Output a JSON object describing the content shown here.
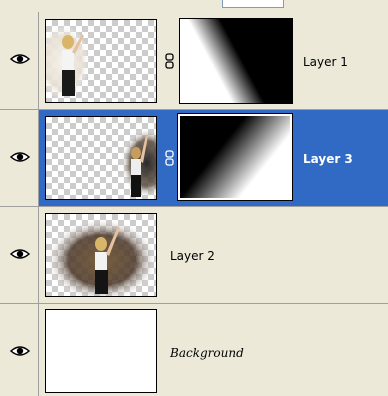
{
  "layers": [
    {
      "name": "Layer 1"
    },
    {
      "name": "Layer 3"
    },
    {
      "name": "Layer 2"
    },
    {
      "name": "Background"
    }
  ],
  "icons": {
    "visibility": "eye-icon",
    "link": "link-chain-icon"
  },
  "colors": {
    "panel": "#ece9d8",
    "selected": "#316ac5",
    "divider": "#a0a0a0"
  }
}
